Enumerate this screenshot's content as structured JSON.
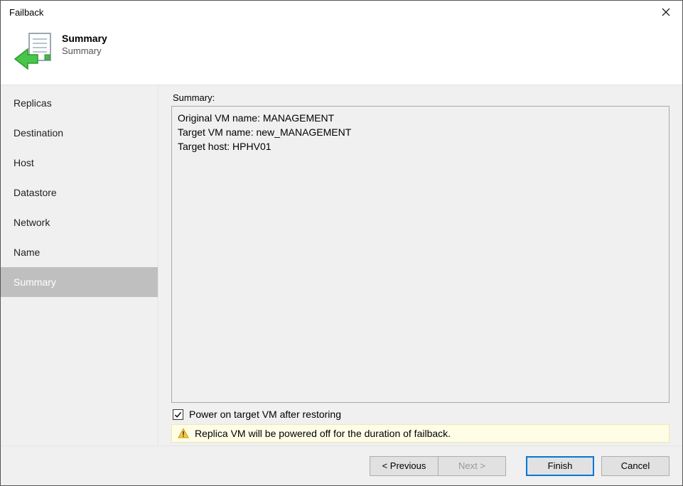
{
  "window": {
    "title": "Failback"
  },
  "header": {
    "title": "Summary",
    "subtitle": "Summary"
  },
  "sidebar": {
    "items": [
      {
        "label": "Replicas",
        "selected": false
      },
      {
        "label": "Destination",
        "selected": false
      },
      {
        "label": "Host",
        "selected": false
      },
      {
        "label": "Datastore",
        "selected": false
      },
      {
        "label": "Network",
        "selected": false
      },
      {
        "label": "Name",
        "selected": false
      },
      {
        "label": "Summary",
        "selected": true
      }
    ]
  },
  "main": {
    "summary_label": "Summary:",
    "summary_lines": [
      "Original VM name: MANAGEMENT",
      "Target VM name: new_MANAGEMENT",
      "Target host: HPHV01"
    ],
    "checkbox_label": "Power on target VM after restoring",
    "checkbox_checked": true,
    "warning_text": "Replica VM will be powered off for the duration of failback."
  },
  "footer": {
    "previous": "< Previous",
    "next": "Next >",
    "next_disabled": true,
    "finish": "Finish",
    "cancel": "Cancel"
  }
}
